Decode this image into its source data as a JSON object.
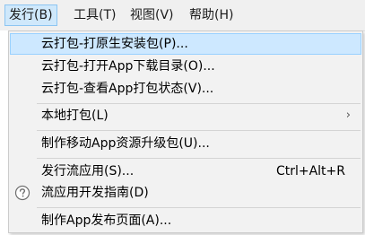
{
  "menubar": {
    "items": [
      {
        "label": "发行(B)",
        "active": true
      },
      {
        "label": "工具(T)"
      },
      {
        "label": "视图(V)"
      },
      {
        "label": "帮助(H)"
      }
    ]
  },
  "menu": {
    "items": [
      {
        "label": "云打包-打原生安装包(P)..."
      },
      {
        "label": "云打包-打开App下载目录(O)..."
      },
      {
        "label": "云打包-查看App打包状态(V)..."
      },
      {
        "label": "本地打包(L)",
        "arrow": "›"
      },
      {
        "label": "制作移动App资源升级包(U)..."
      },
      {
        "label": "发行流应用(S)...",
        "shortcut": "Ctrl+Alt+R"
      },
      {
        "label": "流应用开发指南(D)",
        "icon": "help-circle-icon"
      },
      {
        "label": "制作App发布页面(A)..."
      }
    ]
  },
  "colors": {
    "highlight": "#cde8ff",
    "highlight_border": "#99d1ff",
    "menu_bg": "#f2f2f2"
  }
}
